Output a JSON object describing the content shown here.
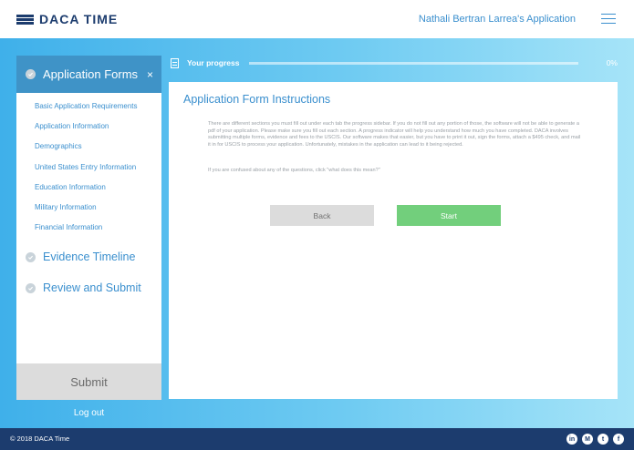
{
  "header": {
    "logo_text": "DACA TIME",
    "user_application": "Nathali Bertran Larrea's Application"
  },
  "progress": {
    "label": "Your progress",
    "percent_text": "0%",
    "value": 0
  },
  "sidebar": {
    "active_section": {
      "label": "Application Forms",
      "close_icon": "×",
      "items": [
        {
          "label": "Basic Application Requirements"
        },
        {
          "label": "Application Information"
        },
        {
          "label": "Demographics"
        },
        {
          "label": "United States Entry Information"
        },
        {
          "label": "Education Information"
        },
        {
          "label": "Military Information"
        },
        {
          "label": "Financial Information"
        }
      ]
    },
    "sections": [
      {
        "label": "Evidence Timeline"
      },
      {
        "label": "Review and Submit"
      }
    ],
    "submit_label": "Submit",
    "logout_label": "Log out"
  },
  "card": {
    "title": "Application Form Instructions",
    "instructions": "There are different sections you must fill out under each tab the progress sidebar. If you do not fill out any portion of those, the software will not be able to generate a pdf of your application. Please make sure you fill out each section. A progress indicator will help you understand how much you have completed. DACA involves submitting multiple forms, evidence and fees to the USCIS. Our software makes that easier, but you have to print it out, sign the forms, attach a $495 check, and mail it in for USCIS to process your application. Unfortunately, mistakes in the application can lead to it being rejected.",
    "note": "If you are confused about any of the questions, click \"what does this mean?\"",
    "back_label": "Back",
    "start_label": "Start"
  },
  "footer": {
    "copyright": "© 2018 DACA Time",
    "social": [
      {
        "icon": "linkedin-icon",
        "glyph": "in"
      },
      {
        "icon": "medium-icon",
        "glyph": "M"
      },
      {
        "icon": "twitter-icon",
        "glyph": "t"
      },
      {
        "icon": "facebook-icon",
        "glyph": "f"
      }
    ]
  },
  "colors": {
    "brand_navy": "#1c3c6e",
    "link_blue": "#3a8fce",
    "active_tab": "#3f93c7",
    "start_green": "#72cf7c"
  }
}
